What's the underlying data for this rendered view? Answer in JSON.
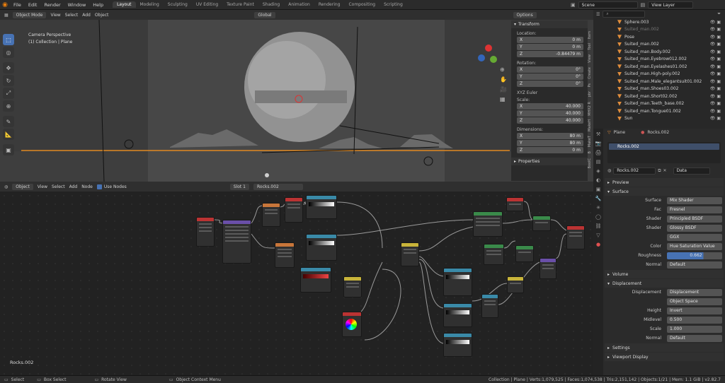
{
  "topbar": {
    "menus": [
      "File",
      "Edit",
      "Render",
      "Window",
      "Help"
    ],
    "workspaces": [
      "Layout",
      "Modeling",
      "Sculpting",
      "UV Editing",
      "Texture Paint",
      "Shading",
      "Animation",
      "Rendering",
      "Compositing",
      "Scripting"
    ],
    "scene": "Scene",
    "view_layer": "View Layer"
  },
  "viewport": {
    "mode": "Object Mode",
    "menus": [
      "View",
      "Select",
      "Add",
      "Object"
    ],
    "orientation": "Global",
    "options": "Options",
    "overlay_title": "Camera Perspective",
    "overlay_sub": "(1) Collection | Plane"
  },
  "npanel": {
    "title": "Transform",
    "location_label": "Location:",
    "loc": {
      "x": "0 m",
      "y": "0 m",
      "z": "-0.84479 m"
    },
    "rotation_label": "Rotation:",
    "rot": {
      "x": "0°",
      "y": "0°",
      "z": "0°"
    },
    "euler": "XYZ Euler",
    "scale_label": "Scale:",
    "scale": {
      "x": "40.000",
      "y": "40.000",
      "z": "40.000"
    },
    "dims_label": "Dimensions:",
    "dims": {
      "x": "80 m",
      "y": "80 m",
      "z": "0 m"
    },
    "axis": {
      "x": "X",
      "y": "Y",
      "z": "Z"
    },
    "properties": "Properties",
    "tabs": [
      "Item",
      "Tool",
      "View",
      "Create",
      "Ps",
      "pbr",
      "MHX2 R",
      "MakeH",
      "MakeT",
      "B",
      "BoolC"
    ]
  },
  "node_editor": {
    "type": "Object",
    "menus": [
      "View",
      "Select",
      "Add",
      "Node"
    ],
    "use_nodes": "Use Nodes",
    "slot": "Slot 1",
    "material": "Rocks.002",
    "footer": "Rocks.002"
  },
  "outliner": {
    "items": [
      {
        "name": "Sphere.003",
        "dim": false
      },
      {
        "name": "Suited_man.002",
        "dim": true
      },
      {
        "name": "Pose",
        "dim": false
      },
      {
        "name": "Suited_man.002",
        "dim": false
      },
      {
        "name": "Suited_man.Body.002",
        "dim": false
      },
      {
        "name": "Suited_man.Eyebrow012.002",
        "dim": false
      },
      {
        "name": "Suited_man.Eyelashes01.002",
        "dim": false
      },
      {
        "name": "Suited_man.High-poly.002",
        "dim": false
      },
      {
        "name": "Suited_man.Male_elegantsuit01.002",
        "dim": false
      },
      {
        "name": "Suited_man.Shoes03.002",
        "dim": false
      },
      {
        "name": "Suited_man.Short02.002",
        "dim": false
      },
      {
        "name": "Suited_man.Teeth_base.002",
        "dim": false
      },
      {
        "name": "Suited_man.Tongue01.002",
        "dim": false
      },
      {
        "name": "Sun",
        "dim": false
      }
    ]
  },
  "properties": {
    "object": "Plane",
    "material": "Rocks.002",
    "slot_item": "Rocks.002",
    "mat_name": "Rocks.002",
    "link": "Data",
    "sections": {
      "preview": "Preview",
      "surface": "Surface",
      "volume": "Volume",
      "displacement": "Displacement",
      "settings": "Settings",
      "viewport": "Viewport Display"
    },
    "surface_rows": [
      {
        "label": "Surface",
        "value": "Mix Shader"
      },
      {
        "label": "Fac",
        "value": "Fresnel"
      },
      {
        "label": "Shader",
        "value": "Principled BSDF"
      },
      {
        "label": "Shader",
        "value": "Glossy BSDF"
      },
      {
        "label": "",
        "value": "GGX"
      },
      {
        "label": "Color",
        "value": "Hue Saturation Value"
      },
      {
        "label": "Roughness",
        "value": "0.662"
      },
      {
        "label": "Normal",
        "value": "Default"
      }
    ],
    "disp_rows": [
      {
        "label": "Displacement",
        "value": "Displacement"
      },
      {
        "label": "",
        "value": "Object Space"
      },
      {
        "label": "Height",
        "value": "Invert"
      },
      {
        "label": "Midlevel",
        "value": "0.500"
      },
      {
        "label": "Scale",
        "value": "1.000"
      },
      {
        "label": "Normal",
        "value": "Default"
      }
    ],
    "roughness_fraction": 0.662
  },
  "status": {
    "select": "Select",
    "box": "Box Select",
    "rotate": "Rotate View",
    "ctx": "Object Context Menu",
    "stats": "Collection | Plane | Verts:1,079,525 | Faces:1,074,538 | Tris:2,151,142 | Objects:1/21 | Mem: 1.1 GiB | v2.82.7"
  },
  "colors": {
    "accent": "#4772b3",
    "brand": "#e87d0d",
    "active_orange": "#f5a623"
  }
}
